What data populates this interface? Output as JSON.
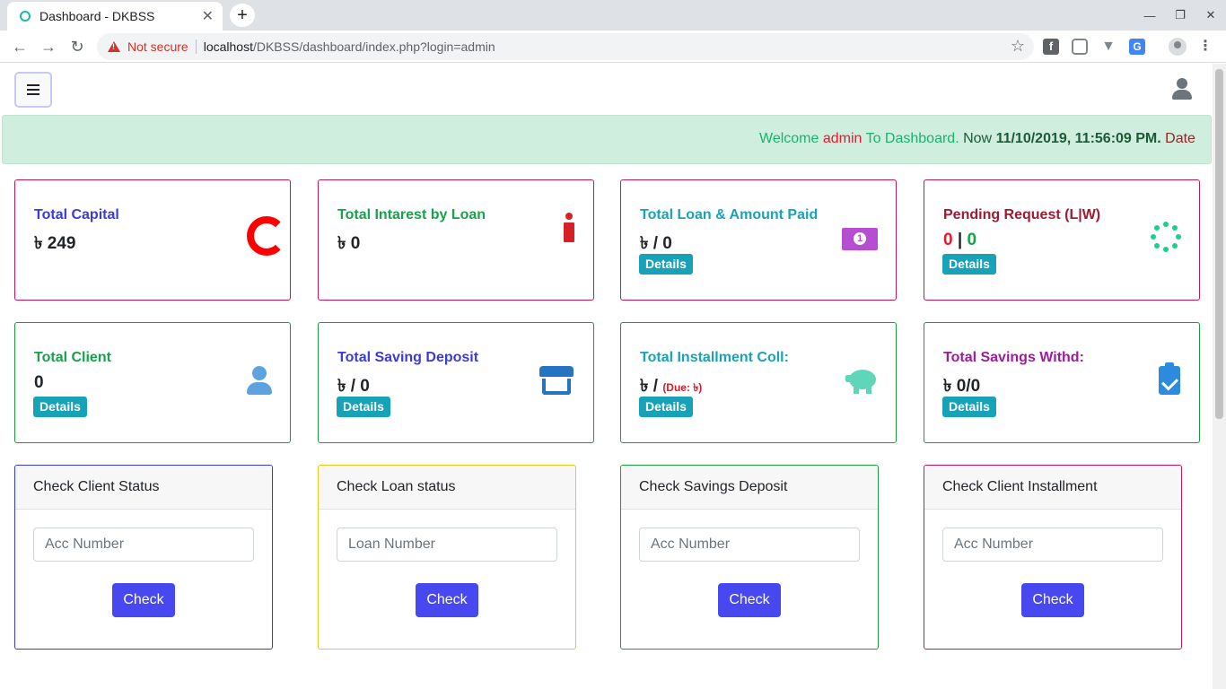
{
  "browser": {
    "tab_title": "Dashboard - DKBSS",
    "tab_close": "✕",
    "new_tab": "+",
    "not_secure": "Not secure",
    "url_host": "localhost",
    "url_path": "/DKBSS/dashboard/index.php?login=admin",
    "back": "←",
    "forward": "→",
    "reload": "↻",
    "star": "☆",
    "minimize": "—",
    "restore": "❐",
    "close": "✕"
  },
  "welcome": {
    "welcome_word": "Welcome",
    "user": "admin",
    "to_dashboard": "To Dashboard.",
    "now_label": "Now",
    "datetime": "11/10/2019, 11:56:09 PM.",
    "date_label": "Date"
  },
  "stats": [
    {
      "title": "Total Capital",
      "title_color": "#3b3bdd",
      "value": "৳ 249",
      "icon": "c-icon",
      "details": null
    },
    {
      "title": "Total Intarest by Loan",
      "title_color": "#16a34a",
      "value": "৳ 0",
      "icon": "info-icon",
      "details": null
    },
    {
      "title": "Total Loan & Amount Paid",
      "title_color": "#1aa3b8",
      "value": "৳ / 0",
      "icon": "money-bill-icon",
      "details": "Details"
    },
    {
      "title": "Pending Request (L|W)",
      "title_color": "#9e1b32",
      "value_left": "0",
      "value_sep": "|",
      "value_right": "0",
      "icon": "spinner-icon",
      "details": "Details"
    },
    {
      "title": "Total Client",
      "title_color": "#16a34a",
      "value": "0",
      "icon": "user-icon",
      "details": "Details"
    },
    {
      "title": "Total Saving Deposit",
      "title_color": "#3b3bdd",
      "value": "৳ / 0",
      "icon": "store-icon",
      "details": "Details"
    },
    {
      "title": "Total Installment Coll:",
      "title_color": "#1aa3b8",
      "value": "৳ /",
      "due": "(Due: ৳)",
      "icon": "piggy-bank-icon",
      "details": "Details"
    },
    {
      "title": "Total Savings Withd:",
      "title_color": "#9c1d9c",
      "value": "৳ 0/0",
      "icon": "clipboard-check-icon",
      "details": "Details"
    }
  ],
  "panels": [
    {
      "title": "Check Client Status",
      "placeholder": "Acc Number",
      "button": "Check",
      "border": "#3a3ad6"
    },
    {
      "title": "Check Loan status",
      "placeholder": "Loan Number",
      "button": "Check",
      "border": "#f0c419"
    },
    {
      "title": "Check Savings Deposit",
      "placeholder": "Acc Number",
      "button": "Check",
      "border": "#1c9b3c"
    },
    {
      "title": "Check Client Installment",
      "placeholder": "Acc Number",
      "button": "Check",
      "border": "#c2185b"
    }
  ],
  "colors": {
    "welcome_bg": "#cfeede",
    "details_bg": "#17a2b8",
    "check_button": "#4848f0",
    "card_border_red": "#c2185b",
    "card_border_green": "#1c9b3c"
  }
}
